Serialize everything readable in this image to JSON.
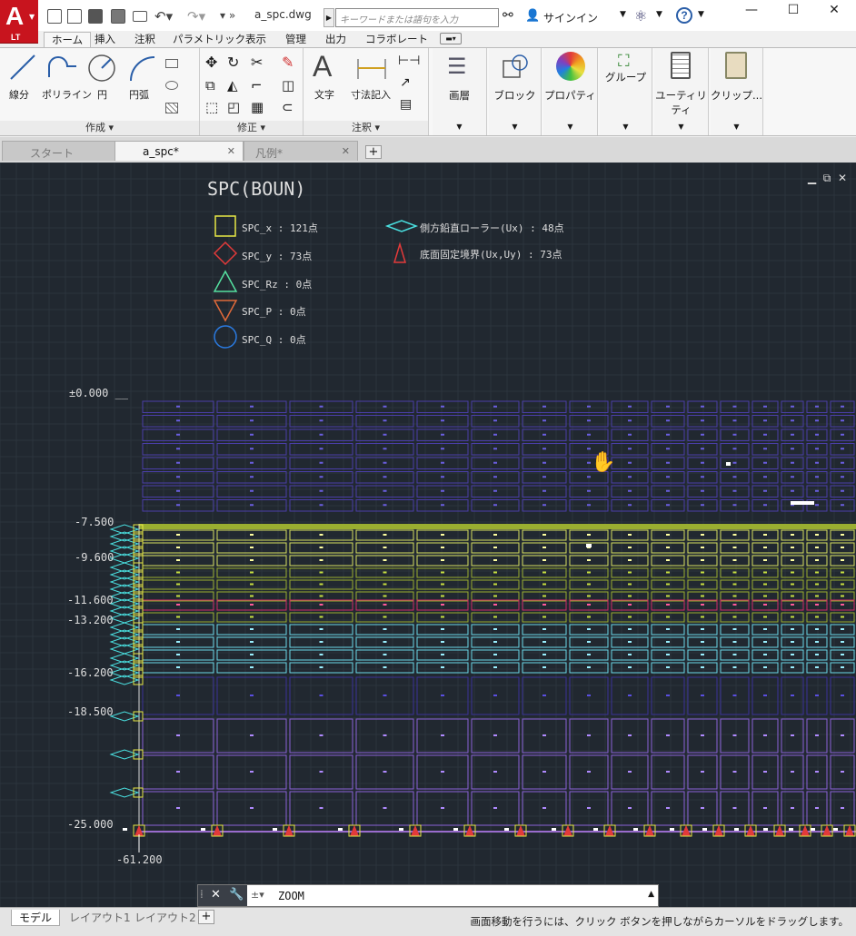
{
  "app": {
    "logo_letter": "A",
    "logo_sub": "LT",
    "document_title": "a_spc.dwg",
    "search_placeholder": "キーワードまたは語句を入力",
    "signin_label": "サインイン",
    "help_label": "?"
  },
  "ribbon": {
    "tabs": [
      "ホーム",
      "挿入",
      "注釈",
      "パラメトリック",
      "表示",
      "管理",
      "出力",
      "コラボレート"
    ],
    "active_tab": "ホーム",
    "draw": {
      "line_label": "線分",
      "polyline_label": "ポリライン",
      "circle_label": "円",
      "arc_label": "円弧",
      "panel_label": "作成"
    },
    "modify_panel_label": "修正",
    "annotation": {
      "text_label": "文字",
      "dimension_label": "寸法記入",
      "panel_label": "注釈"
    },
    "layers_label": "画層",
    "block_label": "ブロック",
    "properties_label": "プロパティ",
    "groups_label": "グループ",
    "utilities_label": "ユーティリティ",
    "clipboard_label": "クリップ..."
  },
  "document_tabs": [
    {
      "label": "スタート",
      "active": false
    },
    {
      "label": "a_spc*",
      "active": true
    },
    {
      "label": "凡例*",
      "active": false
    }
  ],
  "drawing": {
    "title": "SPC(BOUN)",
    "legend": [
      {
        "symbol": "square",
        "label": "SPC_x",
        "count": "121点",
        "color": "#e8e845"
      },
      {
        "symbol": "diamond",
        "label": "SPC_y",
        "count": "73点",
        "color": "#e23a3a"
      },
      {
        "symbol": "triangle-up",
        "label": "SPC_Rz",
        "count": "0点",
        "color": "#55e0a0"
      },
      {
        "symbol": "triangle-down",
        "label": "SPC_P",
        "count": "0点",
        "color": "#e06a3a"
      },
      {
        "symbol": "circle",
        "label": "SPC_Q",
        "count": "0点",
        "color": "#2a7ae0"
      }
    ],
    "legend_right": [
      {
        "symbol": "diamond-flat",
        "label": "側方鉛直ローラー(Ux)",
        "count": "48点",
        "color": "#4ae0e0"
      },
      {
        "symbol": "triangle-red",
        "label": "底面固定境界(Ux,Uy)",
        "count": "73点",
        "color": "#e23a3a"
      }
    ],
    "elevations": [
      "±0.000",
      "-7.500",
      "-9.600",
      "-11.600",
      "-13.200",
      "-16.200",
      "-18.500",
      "-25.000"
    ],
    "x_label": "-61.200",
    "layer_colors": {
      "top": "#4a3ea8",
      "yellow": "#d8e060",
      "olive": "#9aae30",
      "magenta": "#d02a6a",
      "cyan": "#6ad8e8",
      "deep": "#3a3298",
      "violet": "#8a62d8",
      "support": "#4ae0e0",
      "fixed": "#e23a3a"
    }
  },
  "command_line": {
    "text": "ZOOM"
  },
  "layout_tabs": [
    "モデル",
    "レイアウト1",
    "レイアウト2"
  ],
  "status_message": "画面移動を行うには、クリック ボタンを押しながらカーソルをドラッグします。"
}
